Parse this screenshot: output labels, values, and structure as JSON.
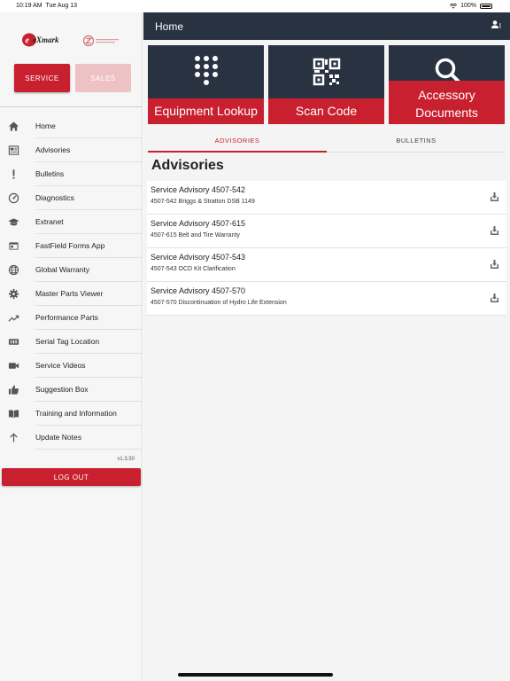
{
  "status_bar": {
    "time": "10:19 AM",
    "date": "Tue Aug 13",
    "battery": "100%"
  },
  "sidebar": {
    "logo_text": "eXmark",
    "segment": {
      "service": "SERVICE",
      "sales": "SALES"
    },
    "items": [
      {
        "label": "Home",
        "icon": "home-icon"
      },
      {
        "label": "Advisories",
        "icon": "newspaper-icon"
      },
      {
        "label": "Bulletins",
        "icon": "exclamation-icon"
      },
      {
        "label": "Diagnostics",
        "icon": "gauge-icon"
      },
      {
        "label": "Extranet",
        "icon": "graduation-cap-icon"
      },
      {
        "label": "FastField Forms App",
        "icon": "window-icon"
      },
      {
        "label": "Global Warranty",
        "icon": "globe-icon"
      },
      {
        "label": "Master Parts Viewer",
        "icon": "gear-icon"
      },
      {
        "label": "Performance Parts",
        "icon": "trending-up-icon"
      },
      {
        "label": "Serial Tag Location",
        "icon": "barcode-tag-icon"
      },
      {
        "label": "Service Videos",
        "icon": "video-camera-icon"
      },
      {
        "label": "Suggestion Box",
        "icon": "thumbs-up-icon"
      },
      {
        "label": "Training and Information",
        "icon": "book-icon"
      },
      {
        "label": "Update Notes",
        "icon": "arrow-up-icon"
      }
    ],
    "version": "v1.3.50",
    "logout": "LOG OUT"
  },
  "header": {
    "title": "Home"
  },
  "tiles": [
    {
      "label": "Equipment Lookup",
      "icon": "keypad-icon"
    },
    {
      "label": "Scan Code",
      "icon": "qr-code-icon"
    },
    {
      "label_line1": "Accessory",
      "label_line2": "Documents",
      "icon": "search-icon"
    }
  ],
  "tabs": {
    "advisories": "ADVISORIES",
    "bulletins": "BULLETINS",
    "active": "advisories"
  },
  "section_title": "Advisories",
  "advisories": [
    {
      "title": "Service Advisory 4507-542",
      "subtitle": "4507-542 Briggs & Stratton DSB 1149"
    },
    {
      "title": "Service Advisory 4507-615",
      "subtitle": "4507-615 Belt and Tire Warranty"
    },
    {
      "title": "Service Advisory 4507-543",
      "subtitle": "4507-543 OCD Kit Clarification"
    },
    {
      "title": "Service Advisory 4507-570",
      "subtitle": "4507-570 Discontinuation of Hydro Life Extension"
    }
  ],
  "colors": {
    "brand_red": "#c8202e",
    "header_navy": "#293241",
    "sales_disabled": "#eec2c5"
  }
}
